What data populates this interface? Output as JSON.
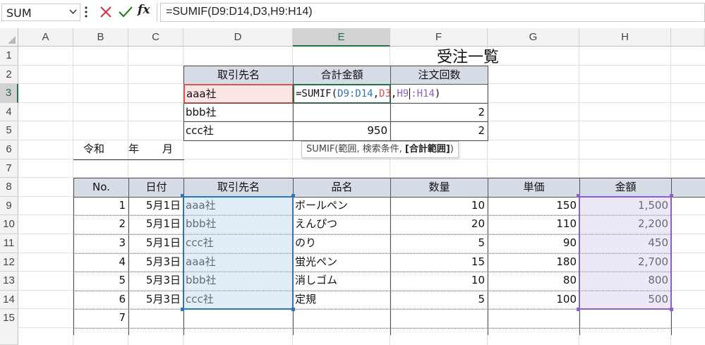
{
  "formula_bar": {
    "name_box": "SUM",
    "fx_label": "fx",
    "formula": "=SUMIF(D9:D14,D3,H9:H14)"
  },
  "columns": [
    "A",
    "B",
    "C",
    "D",
    "E",
    "F",
    "G",
    "H"
  ],
  "rows": [
    "1",
    "2",
    "3",
    "4",
    "5",
    "6",
    "7",
    "8",
    "9",
    "10",
    "11",
    "12",
    "13",
    "14",
    "15"
  ],
  "title": "受注一覧",
  "summary": {
    "headers": [
      "取引先名",
      "合計金額",
      "注文回数"
    ],
    "rows": [
      {
        "name": "aaa社",
        "formula_parts": [
          "=SUMIF(",
          "D9:D14",
          ",",
          "D3",
          ",",
          "H9",
          "",
          "H14",
          ")"
        ],
        "count": ""
      },
      {
        "name": "bbb社",
        "total": "",
        "count": "2"
      },
      {
        "name": "ccc社",
        "total": "950",
        "count": "2"
      }
    ]
  },
  "tooltip": {
    "func": "SUMIF(",
    "args": "範囲, 検索条件, ",
    "current": "[合計範囲]",
    "close": ")"
  },
  "date_label": {
    "era": "令和",
    "year": "年",
    "month": "月"
  },
  "orders": {
    "headers": [
      "No.",
      "日付",
      "取引先名",
      "品名",
      "数量",
      "単価",
      "金額"
    ],
    "rows": [
      {
        "no": "1",
        "date": "5月1日",
        "client": "aaa社",
        "item": "ボールペン",
        "qty": "10",
        "price": "150",
        "amount": "1,500"
      },
      {
        "no": "2",
        "date": "5月1日",
        "client": "bbb社",
        "item": "えんぴつ",
        "qty": "20",
        "price": "110",
        "amount": "2,200"
      },
      {
        "no": "3",
        "date": "5月1日",
        "client": "ccc社",
        "item": "のり",
        "qty": "5",
        "price": "90",
        "amount": "450"
      },
      {
        "no": "4",
        "date": "5月3日",
        "client": "aaa社",
        "item": "蛍光ペン",
        "qty": "15",
        "price": "180",
        "amount": "2,700"
      },
      {
        "no": "5",
        "date": "5月3日",
        "client": "bbb社",
        "item": "消しゴム",
        "qty": "10",
        "price": "80",
        "amount": "800"
      },
      {
        "no": "6",
        "date": "5月3日",
        "client": "ccc社",
        "item": "定規",
        "qty": "5",
        "price": "100",
        "amount": "500"
      },
      {
        "no": "7",
        "date": "",
        "client": "",
        "item": "",
        "qty": "",
        "price": "",
        "amount": ""
      }
    ]
  },
  "colors": {
    "range1": "#2e75b6",
    "range2": "#d9534f",
    "range3": "#8d5ec9",
    "header_fill": "#d6dce5",
    "accent": "#217346"
  }
}
